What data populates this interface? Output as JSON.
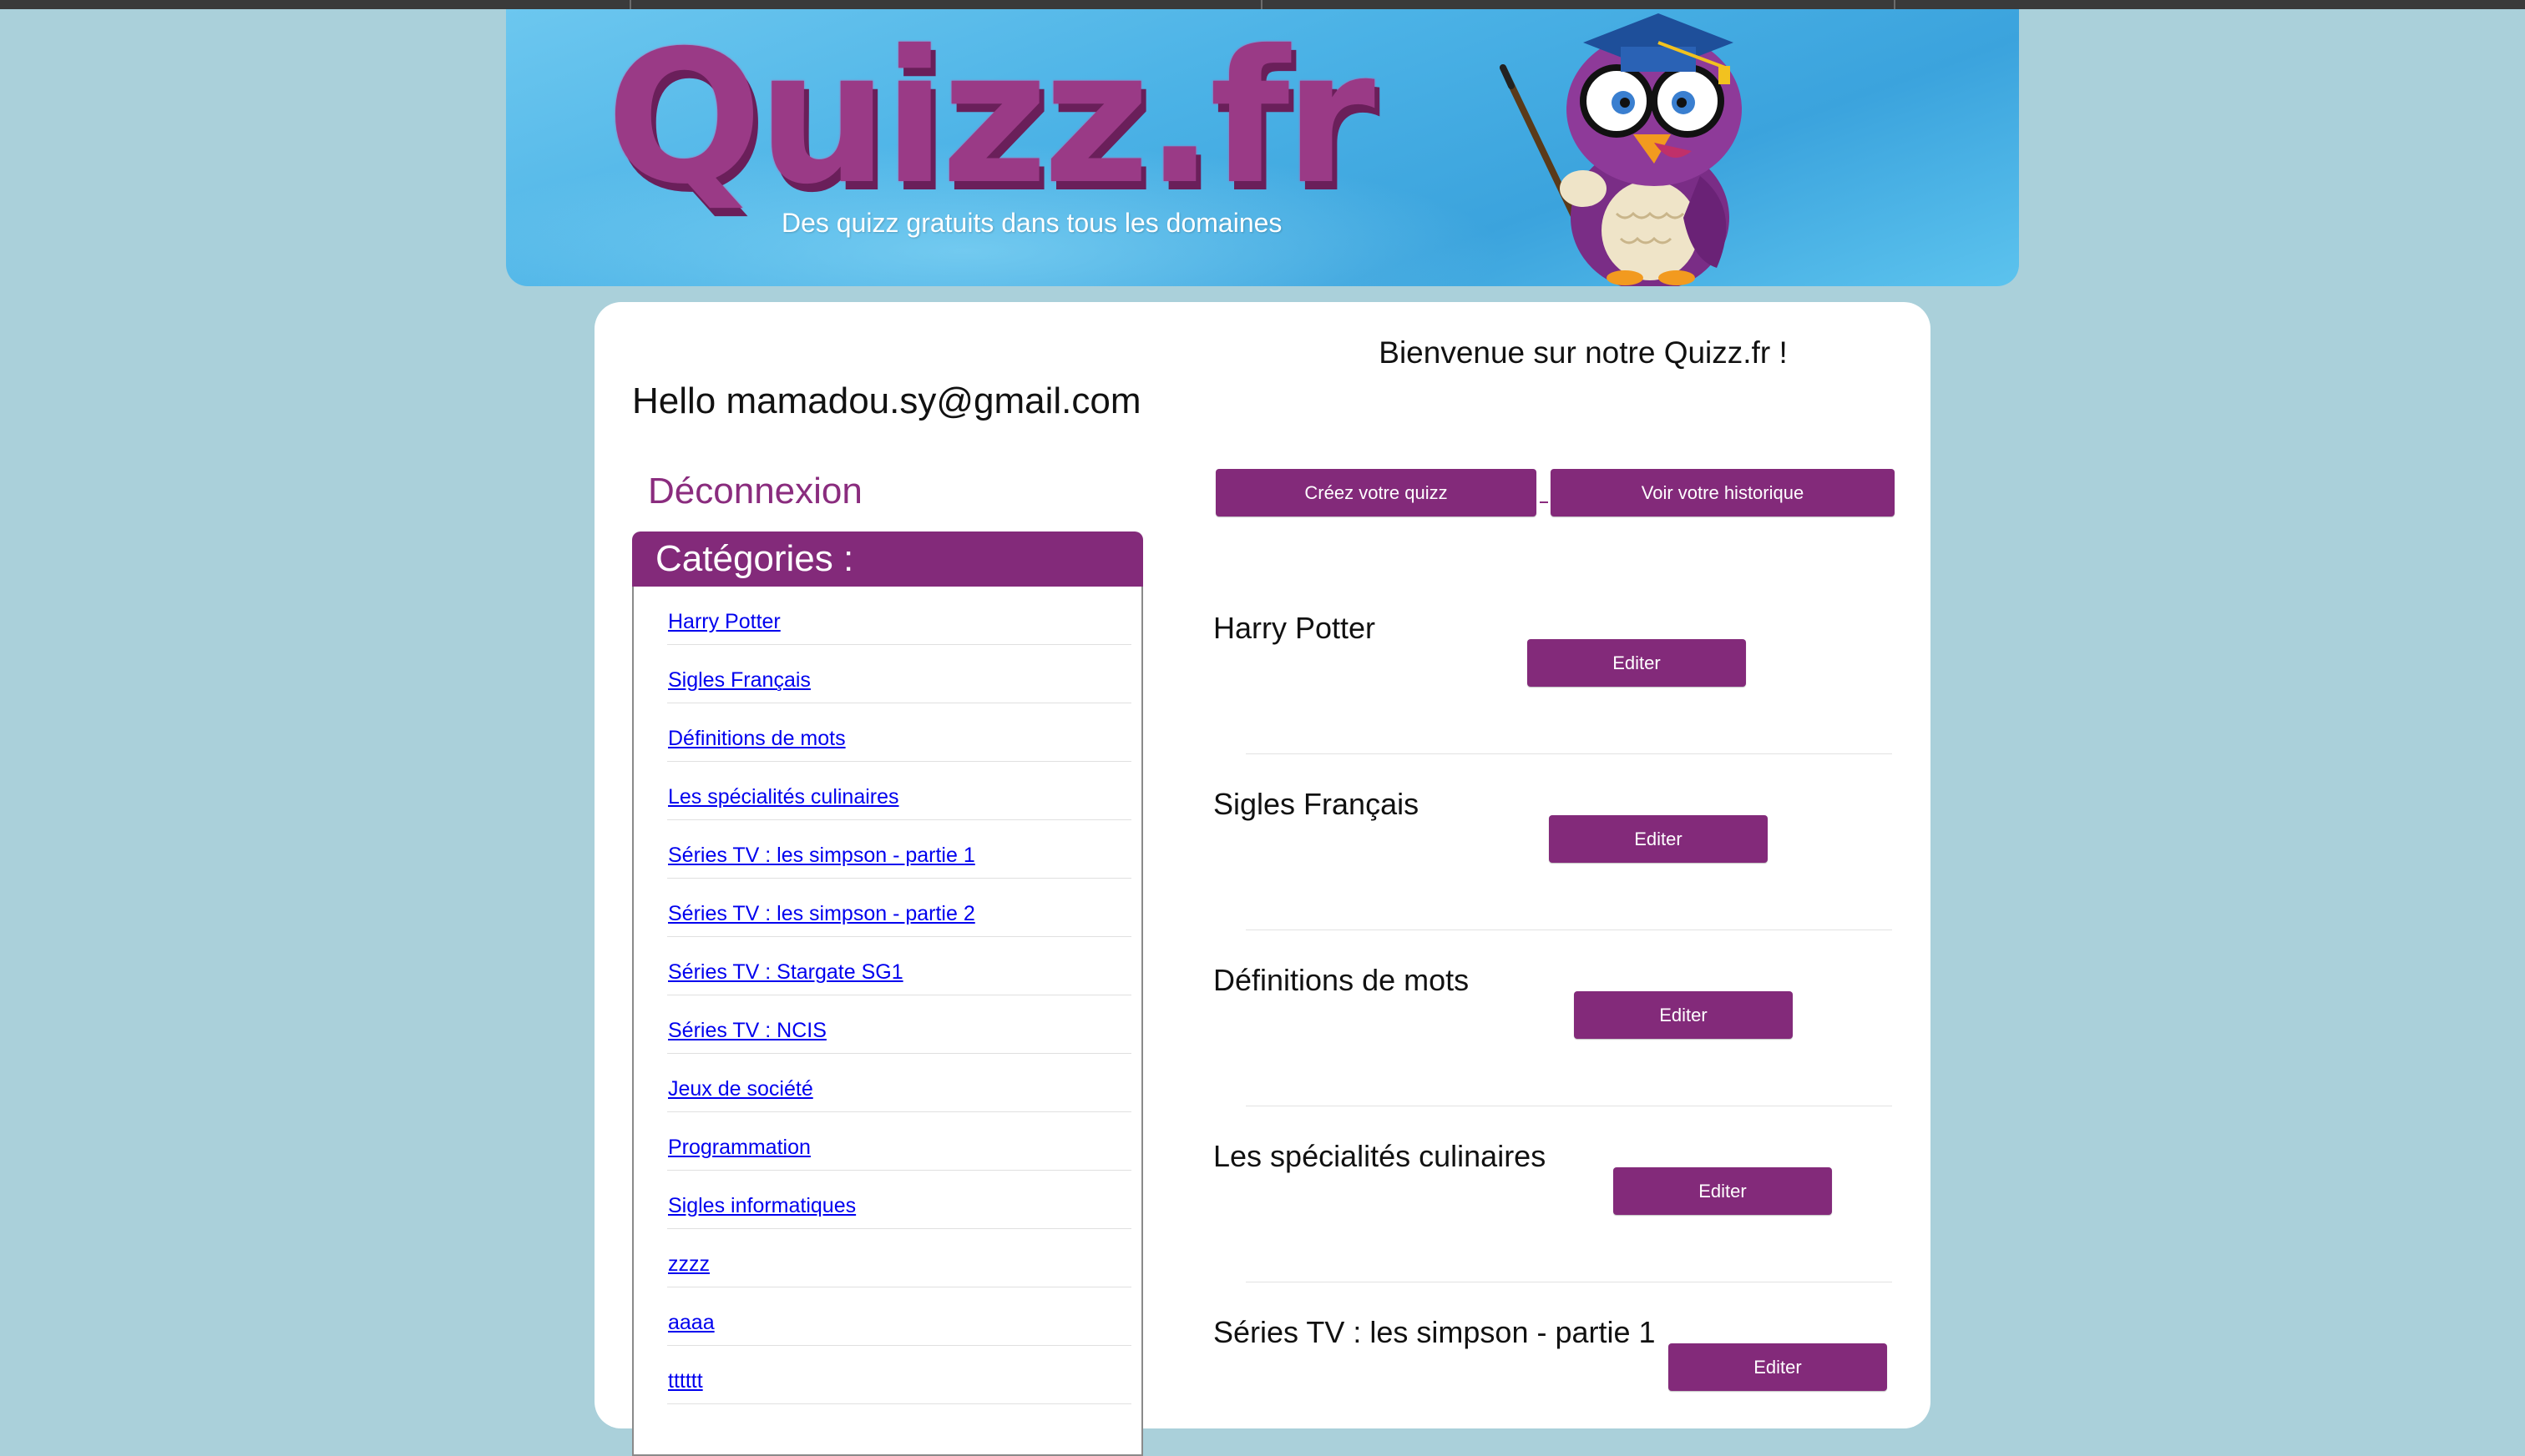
{
  "banner": {
    "logo_text": "Quizz.fr",
    "tagline": "Des quizz gratuits dans tous les domaines"
  },
  "card": {
    "welcome": "Bienvenue sur notre Quizz.fr !",
    "hello": "Hello mamadou.sy@gmail.com",
    "logout": "Déconnexion",
    "create_label": "Créez votre quizz",
    "history_label": "Voir votre historique"
  },
  "categories": {
    "title": "Catégories :",
    "items": [
      "Harry Potter",
      "Sigles Français",
      "Définitions de mots",
      "Les spécialités culinaires",
      "Séries TV : les simpson - partie 1",
      "Séries TV : les simpson - partie 2",
      "Séries TV : Stargate SG1",
      "Séries TV : NCIS",
      "Jeux de société",
      "Programmation",
      "Sigles informatiques",
      "zzzz",
      "aaaa",
      "tttttt"
    ]
  },
  "quizzes": [
    {
      "title": "Harry Potter",
      "edit": "Editer"
    },
    {
      "title": "Sigles Français",
      "edit": "Editer"
    },
    {
      "title": "Définitions de mots",
      "edit": "Editer"
    },
    {
      "title": "Les spécialités culinaires",
      "edit": "Editer"
    },
    {
      "title": "Séries TV : les simpson - partie 1",
      "edit": "Editer"
    }
  ],
  "colors": {
    "page_bg": "#aad0da",
    "accent_purple": "#832a7a",
    "link_blue": "#0000ee",
    "banner_blue": "#4bb2e6"
  }
}
